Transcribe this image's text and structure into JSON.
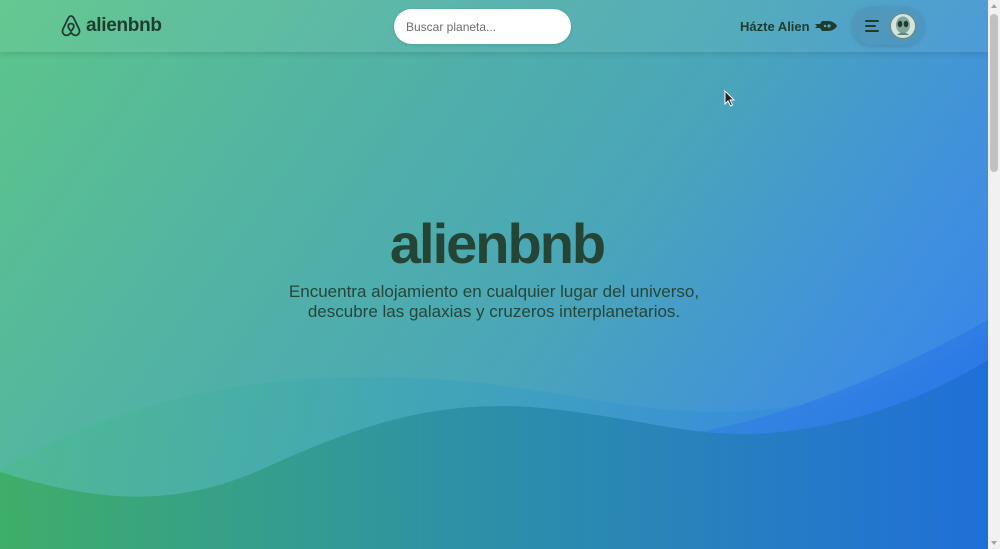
{
  "brand": {
    "name": "alienbnb",
    "icon": "airbnb-logo-icon"
  },
  "search": {
    "placeholder": "Buscar planeta..."
  },
  "nav": {
    "host_label": "Házte Alien",
    "host_icon": "spaceship-icon"
  },
  "user_menu": {
    "menu_icon": "hamburger-menu-icon",
    "avatar_icon": "alien-avatar-icon"
  },
  "hero": {
    "title": "alienbnb",
    "subtitle_line1": "Encuentra alojamiento en cualquier lugar del universo,",
    "subtitle_line2": "descubre las galaxias y cruzeros interplanetarios."
  },
  "colors": {
    "text_dark": "#1e3d2f",
    "gradient_green": "#5cc58a",
    "gradient_blue": "#2f7ef0",
    "wave_green": "#3fae6a",
    "wave_blue": "#1f6fd8"
  }
}
